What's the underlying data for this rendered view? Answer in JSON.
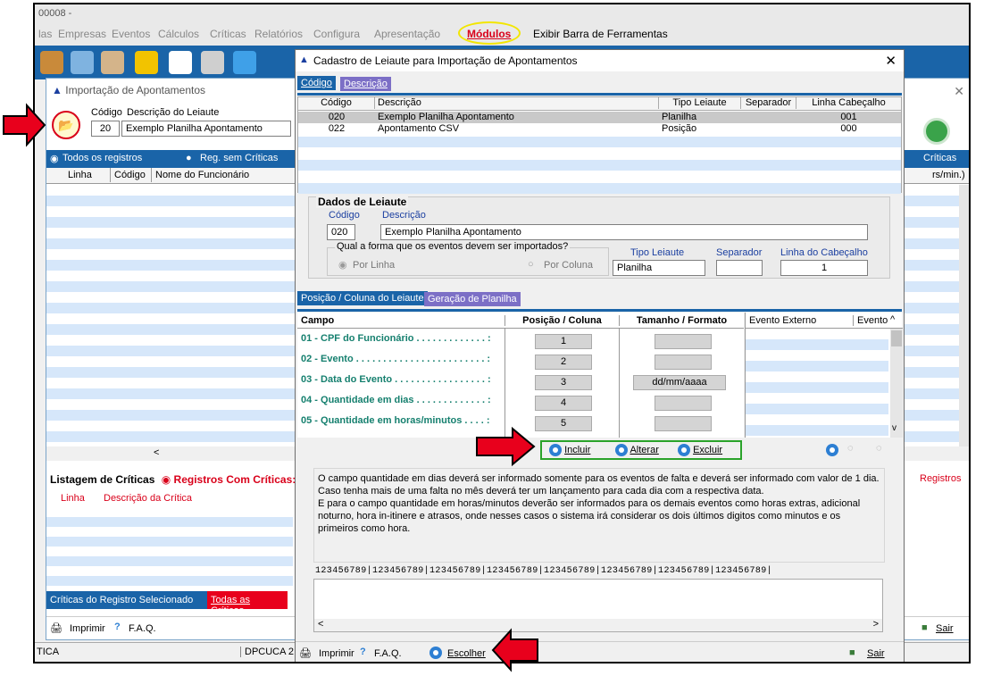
{
  "app": {
    "title_fragment": "00008 -",
    "menu": [
      "las",
      "Empresas",
      "Eventos",
      "Cálculos",
      "Críticas",
      "Relatórios",
      "Configura",
      "Apresentação",
      "Módulos",
      "Exibir Barra de Ferramentas"
    ],
    "menu_highlight": "Módulos"
  },
  "bg_window": {
    "title": "Importação de Apontamentos",
    "codigo_label": "Código",
    "descricao_label": "Descrição do Leiaute",
    "codigo_value": "20",
    "descricao_value": "Exemplo Planilha Apontamento",
    "radio_todos": "Todos os registros",
    "radio_sem": "Reg. sem Críticas",
    "criticas_right": "Críticas",
    "cols": [
      "Linha",
      "Código",
      "Nome do Funcionário"
    ],
    "right_col": "rs/min.)",
    "listagem_label": "Listagem de Críticas",
    "registros_com": "Registros Com Críticas:",
    "registros_right": "Registros",
    "crit_cols": [
      "Linha",
      "Descrição da Crítica"
    ],
    "tab_criticas_sel": "Críticas do Registro Selecionado",
    "tab_todas": "Todas as Críticas",
    "imprimir": "Imprimir",
    "faq": "F.A.Q.",
    "sair": "Sair",
    "status_left": "TICA",
    "status_mid": "DPCUCA 2"
  },
  "modal": {
    "title": "Cadastro de Leiaute para Importação de Apontamentos",
    "tab_codigo": "Código",
    "tab_descricao": "Descrição",
    "cols": [
      "Código",
      "Descrição",
      "Tipo Leiaute",
      "Separador",
      "Linha Cabeçalho"
    ],
    "rows": [
      {
        "codigo": "020",
        "descricao": "Exemplo Planilha Apontamento",
        "tipo": "Planilha",
        "separador": "",
        "linha": "001"
      },
      {
        "codigo": "022",
        "descricao": "Apontamento CSV",
        "tipo": "Posição",
        "separador": "",
        "linha": "000"
      }
    ],
    "dados_title": "Dados de Leiaute",
    "codigo_label": "Código",
    "descricao_label": "Descrição",
    "codigo_value": "020",
    "descricao_value": "Exemplo Planilha Apontamento",
    "forma_label": "Qual a forma que os eventos devem ser importados?",
    "por_linha": "Por Linha",
    "por_coluna": "Por Coluna",
    "tipo_label": "Tipo Leiaute",
    "tipo_value": "Planilha",
    "separador_label": "Separador",
    "separador_value": "",
    "linha_cab_label": "Linha do Cabeçalho",
    "linha_cab_value": "1",
    "tab_posicao": "Posição / Coluna do Leiaute",
    "tab_geracao": "Geração de Planilha",
    "grid_cols": [
      "Campo",
      "Posição / Coluna",
      "Tamanho / Formato",
      "Evento Externo",
      "Evento"
    ],
    "fields": [
      {
        "campo": "01 - CPF do Funcionário . . . . . . . . . . . . . :",
        "pos": "1",
        "fmt": ""
      },
      {
        "campo": "02 - Evento . . . . . . . . . . . . . . . . . . . . . . . . :",
        "pos": "2",
        "fmt": ""
      },
      {
        "campo": "03 - Data do Evento . . . . . . . . . . . . . . . . . :",
        "pos": "3",
        "fmt": "dd/mm/aaaa"
      },
      {
        "campo": "04 - Quantidade em dias . . . . . . . . . . . . . :",
        "pos": "4",
        "fmt": ""
      },
      {
        "campo": "05 - Quantidade em horas/minutos . . . . :",
        "pos": "5",
        "fmt": ""
      }
    ],
    "btn_incluir": "Incluir",
    "btn_alterar": "Alterar",
    "btn_excluir": "Excluir",
    "info_text": "O campo quantidade em dias deverá ser informado somente para os eventos de falta e deverá ser informado com valor de 1 dia. Caso tenha mais de uma falta no mês deverá ter um lançamento para cada dia com a respectiva data.\nE para o campo quantidade em horas/minutos deverão ser informados para os demais eventos como horas extras, adicional noturno, hora in-itinere e atrasos, onde nesses casos o sistema irá considerar os dois últimos digitos como minutos e os primeiros como hora.",
    "ruler": "123456789|123456789|123456789|123456789|123456789|123456789|123456789|123456789|",
    "footer_imprimir": "Imprimir",
    "footer_faq": "F.A.Q.",
    "footer_escolher": "Escolher",
    "footer_sair": "Sair"
  },
  "colors": {
    "blue_bar": "#1a64a8",
    "grid_blue": "#d6e7fa",
    "red_arrow": "#e8001c",
    "yellow_highlight": "#f2e600",
    "green_box": "#2aa32a",
    "teal_text": "#16806f"
  }
}
